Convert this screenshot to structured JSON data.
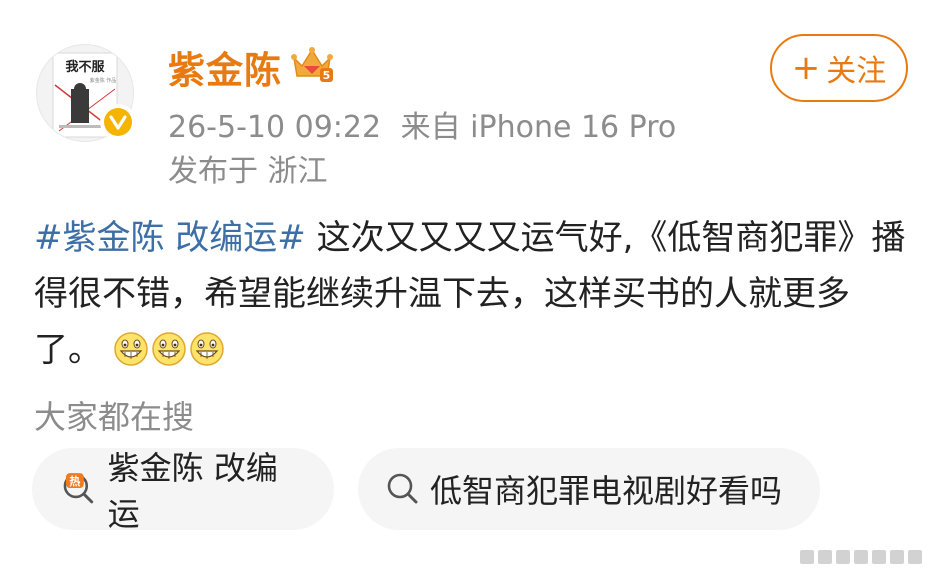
{
  "post": {
    "username": "紫金陈",
    "time": "26-5-10 09:22",
    "source": "来自 iPhone 16 Pro",
    "location": "发布于 浙江",
    "follow_label": "关注",
    "topic": "#紫金陈 改编运#",
    "text": " 这次又又又又运气好,《低智商犯罪》播得很不错，希望能继续升温下去，这样买书的人就更多了。"
  },
  "search": {
    "title": "大家都在搜",
    "chips": [
      {
        "label": "紫金陈 改编运",
        "icon": "hot-search-icon"
      },
      {
        "label": "低智商犯罪电视剧好看吗",
        "icon": "search-icon"
      }
    ]
  },
  "avatar": {
    "book_title": "我不服",
    "author_line": "紫金陈 作品"
  },
  "colors": {
    "username": "#e87a12",
    "topic": "#3d6fa6",
    "meta": "#8c8c8c",
    "chip_bg": "#f5f5f5"
  }
}
